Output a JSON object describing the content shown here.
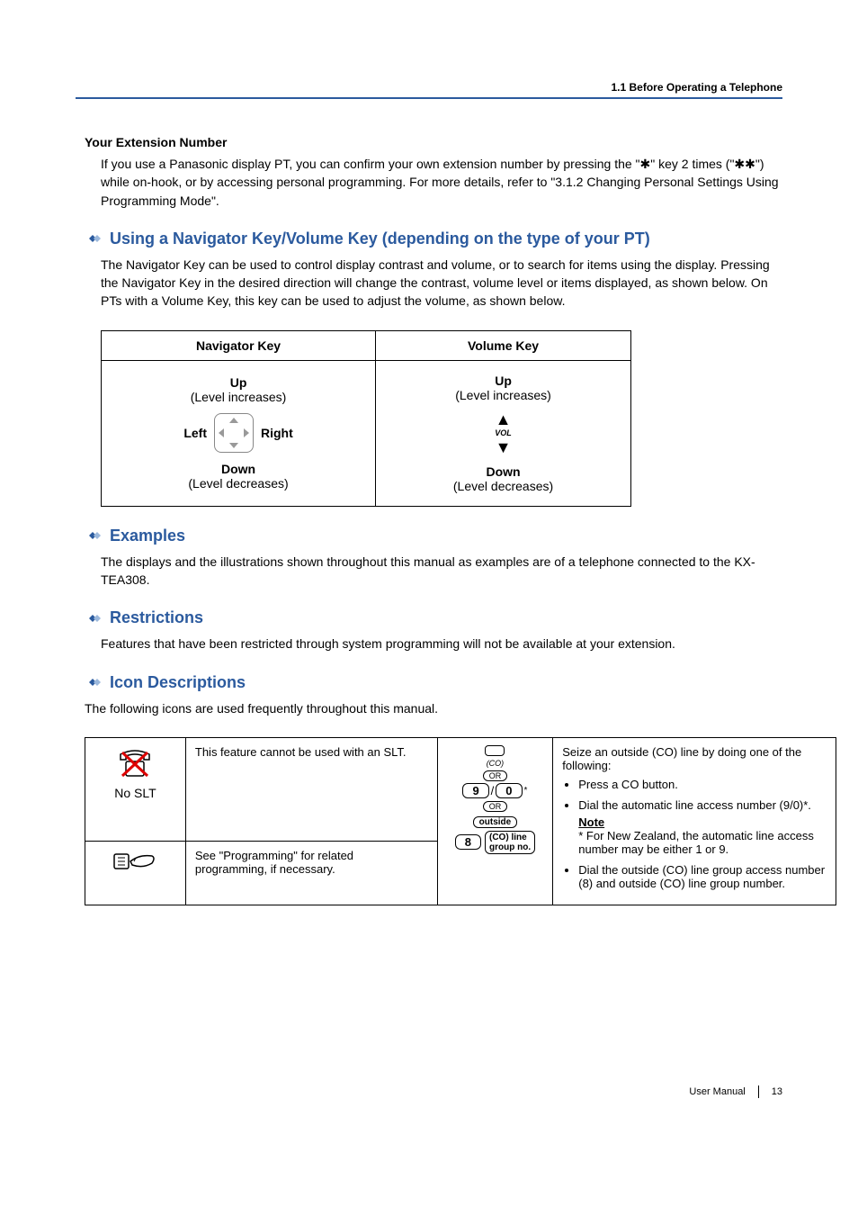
{
  "header": {
    "breadcrumb": "1.1 Before Operating a Telephone"
  },
  "extension": {
    "heading": "Your Extension Number",
    "body": "If you use a Panasonic display PT, you can confirm your own extension number by pressing the \"✱\" key 2 times (\"✱✱\") while on-hook, or by accessing personal programming. For more details, refer to \"3.1.2 Changing Personal Settings Using Programming Mode\"."
  },
  "navigator": {
    "title": "Using a Navigator Key/Volume Key (depending on the type of your PT)",
    "body": "The Navigator Key can be used to control display contrast and volume, or to search for items using the display. Pressing the Navigator Key in the desired direction will change the contrast, volume level or items displayed, as shown below. On PTs with a Volume Key, this key can be used to adjust the volume, as shown below.",
    "table": {
      "col1_header": "Navigator Key",
      "col2_header": "Volume Key",
      "up_label": "Up",
      "up_level": "(Level increases)",
      "down_label": "Down",
      "down_level": "(Level decreases)",
      "left_label": "Left",
      "right_label": "Right",
      "vol_text": "VOL"
    }
  },
  "examples": {
    "title": "Examples",
    "body": "The displays and the illustrations shown throughout this manual as examples are of a telephone connected to the KX-TEA308."
  },
  "restrictions": {
    "title": "Restrictions",
    "body": "Features that have been restricted through system programming will not be available at your extension."
  },
  "icons": {
    "title": "Icon Descriptions",
    "body": "The following icons are used frequently throughout this manual.",
    "no_slt": {
      "label": "No SLT",
      "desc": "This feature cannot be used with an SLT."
    },
    "programming": {
      "desc": "See \"Programming\" for related programming, if necessary."
    },
    "co_diagram": {
      "co_label": "(CO)",
      "or_label": "OR",
      "digit_9": "9",
      "digit_0": "0",
      "digit_8": "8",
      "outside_word": "outside",
      "co_line_text": "(CO) line\ngroup no."
    },
    "co_desc": {
      "intro": "Seize an outside (CO) line by doing one of the following:",
      "item1": "Press a CO button.",
      "item2": "Dial the automatic line access number (9/0)*.",
      "note_label": "Note",
      "note_body": "* For New Zealand, the automatic line access number may be either 1 or 9.",
      "item3": "Dial the outside (CO) line group access number (8) and outside (CO) line group number."
    }
  },
  "footer": {
    "manual": "User Manual",
    "page": "13"
  }
}
